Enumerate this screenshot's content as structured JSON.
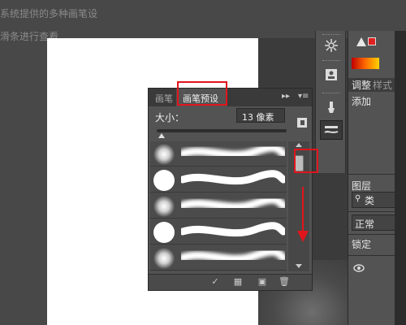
{
  "instructions": {
    "line1": "系统提供的多种画笔设",
    "line2": "滑条进行查看"
  },
  "brush_panel": {
    "tabs": [
      "画笔",
      "画笔预设"
    ],
    "active_tab": "画笔预设",
    "size_label": "大小：",
    "size_value": "13 像素",
    "presets": [
      {
        "type": "soft-round"
      },
      {
        "type": "hard-round"
      },
      {
        "type": "soft-round"
      },
      {
        "type": "hard-round"
      },
      {
        "type": "soft-round"
      }
    ],
    "footer_icons": [
      "brush-toggle-icon",
      "grid-view-icon",
      "new-preset-icon",
      "trash-icon"
    ]
  },
  "right_panel": {
    "tab_adjust": "调整",
    "tab_style": "样式",
    "add_label": "添加",
    "layers_label": "图层",
    "filter_label": "类",
    "blend_mode": "正常",
    "lock_label": "锁定"
  },
  "dock_icons": [
    "compass-icon",
    "user-badge-icon",
    "brush-icon",
    "brush-preset-icon"
  ],
  "colors": {
    "annotation_red": "#e0151b",
    "panel_bg": "#535353"
  }
}
